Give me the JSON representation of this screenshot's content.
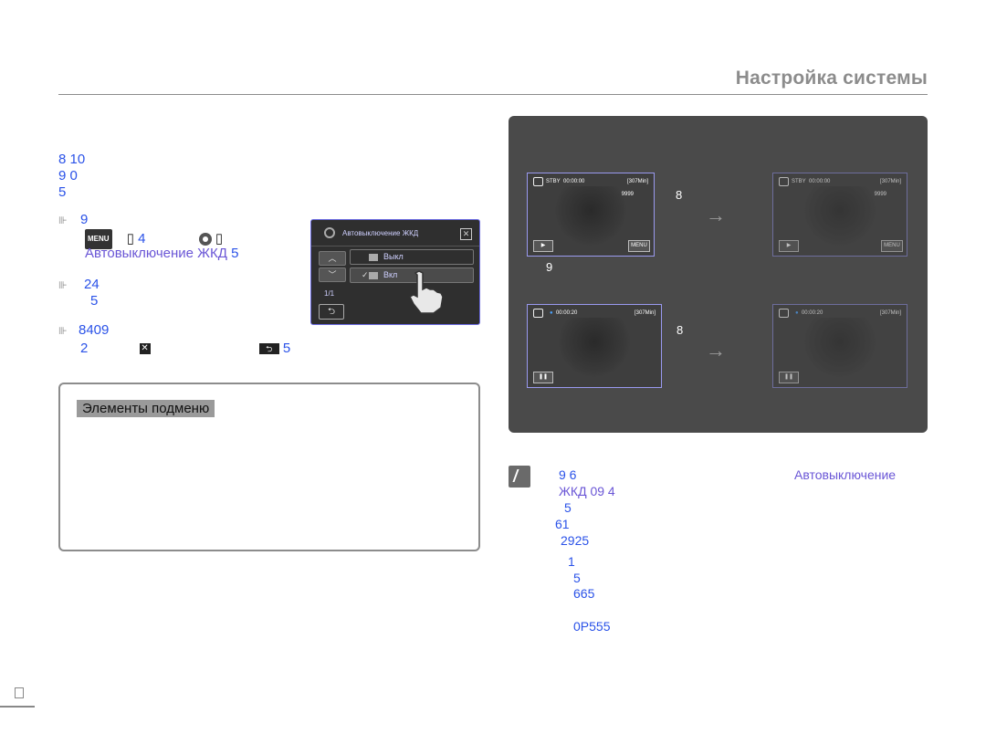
{
  "header": {
    "title": "Настройка системы"
  },
  "intro": {
    "line1": "8 10",
    "line2": "9  0",
    "line3": "5"
  },
  "steps": {
    "s1_num": "9",
    "s1_menu_icon": "MENU",
    "s1_a": "4",
    "s1_label": "Автовыключение ЖКД",
    "s1_label_end": "5",
    "s2_num": "24",
    "s2_line2": "5",
    "s3_num": "8409",
    "s3_a": "2",
    "s3_end": "5"
  },
  "lcd_menu": {
    "title": "Автовыключение ЖКД",
    "option_off": "Выкл",
    "option_on": "Вкл",
    "page": "1/1",
    "close_icon": "close-icon",
    "back_icon": "back-icon"
  },
  "submenu": {
    "title": "Элементы подменю"
  },
  "demo": {
    "num_top": "8",
    "num_top_below": "9",
    "num_bottom": "8",
    "stby": "STBY",
    "tc_top": "00:00:00",
    "remain": "[307Min]",
    "count": "9999",
    "tc_bottom": "00:00:20",
    "menu_btn": "MENU",
    "arrow_glyph": "→"
  },
  "note": {
    "l1_a": "9  6",
    "l1_b": "Автовыключение",
    "l2": "ЖКД 09 4",
    "l3": "5",
    "l4": "61",
    "l5": "2925",
    "l6": "1",
    "l7": "5",
    "l8": "665",
    "l9": "0P555"
  },
  "colors": {
    "accent_blue": "#2a52e8",
    "accent_violet": "#6a56d6",
    "panel_bg": "#4a4a4a"
  }
}
